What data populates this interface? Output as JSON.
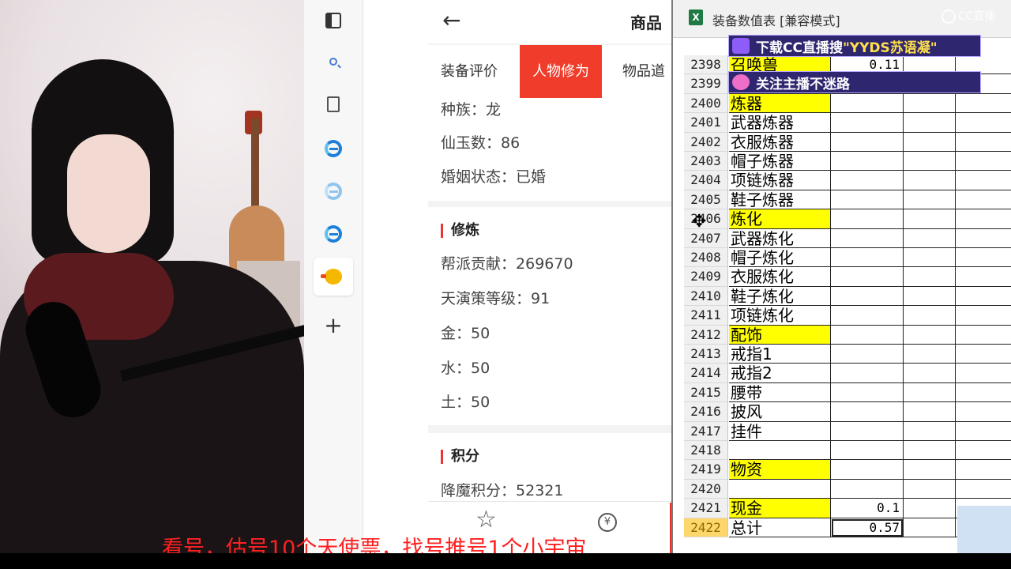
{
  "product_page": {
    "title": "商品",
    "tabs": [
      "装备评价",
      "人物修为",
      "物品道"
    ],
    "active_tab_index": 1,
    "info_rows": [
      {
        "label": "种族：",
        "value": "龙"
      },
      {
        "label": "仙玉数：",
        "value": "86"
      },
      {
        "label": "婚姻状态：",
        "value": "已婚"
      }
    ],
    "cultivation": {
      "title": "修炼",
      "rows": [
        {
          "label": "帮派贡献：",
          "value": "269670"
        },
        {
          "label": "天演策等级：",
          "value": "91"
        },
        {
          "label": "金：",
          "value": "50"
        },
        {
          "label": "水：",
          "value": "50"
        },
        {
          "label": "土：",
          "value": "50"
        }
      ]
    },
    "points": {
      "title": "积分",
      "rows": [
        {
          "label": "降魔积分：",
          "value": "52321"
        }
      ]
    }
  },
  "excel": {
    "title": "装备数值表 [兼容模式]",
    "rows": [
      {
        "num": "2398",
        "a": "召唤兽",
        "b": "0.11",
        "hl": true
      },
      {
        "num": "2399",
        "a": "",
        "b": ""
      },
      {
        "num": "2400",
        "a": "炼器",
        "b": "",
        "hl": true
      },
      {
        "num": "2401",
        "a": "武器炼器",
        "b": ""
      },
      {
        "num": "2402",
        "a": "衣服炼器",
        "b": ""
      },
      {
        "num": "2403",
        "a": "帽子炼器",
        "b": ""
      },
      {
        "num": "2404",
        "a": "项链炼器",
        "b": ""
      },
      {
        "num": "2405",
        "a": "鞋子炼器",
        "b": ""
      },
      {
        "num": "2406",
        "a": "炼化",
        "b": "",
        "hl": true
      },
      {
        "num": "2407",
        "a": "武器炼化",
        "b": ""
      },
      {
        "num": "2408",
        "a": "帽子炼化",
        "b": ""
      },
      {
        "num": "2409",
        "a": "衣服炼化",
        "b": ""
      },
      {
        "num": "2410",
        "a": "鞋子炼化",
        "b": ""
      },
      {
        "num": "2411",
        "a": "项链炼化",
        "b": ""
      },
      {
        "num": "2412",
        "a": "配饰",
        "b": "",
        "hl": true
      },
      {
        "num": "2413",
        "a": "戒指1",
        "b": ""
      },
      {
        "num": "2414",
        "a": "戒指2",
        "b": ""
      },
      {
        "num": "2415",
        "a": "腰带",
        "b": ""
      },
      {
        "num": "2416",
        "a": "披风",
        "b": ""
      },
      {
        "num": "2417",
        "a": "挂件",
        "b": ""
      },
      {
        "num": "2418",
        "a": "",
        "b": ""
      },
      {
        "num": "2419",
        "a": "物资",
        "b": "",
        "hl": true
      },
      {
        "num": "2420",
        "a": "",
        "b": ""
      },
      {
        "num": "2421",
        "a": "现金",
        "b": "0.1",
        "hl": true
      },
      {
        "num": "2422",
        "a": "总计",
        "b": "0.57",
        "selected": true
      }
    ]
  },
  "overlays": {
    "cc_logo": "CC直播",
    "banner1_prefix": "下载CC直播搜",
    "banner1_highlight": "\"YYDS苏语凝\"",
    "banner2": "关注主播不迷路",
    "subtitle": "看号，估号10个天使票，找号推号1个小宇宙"
  },
  "colors": {
    "accent_red": "#f03c2b",
    "cell_highlight": "#ffff00",
    "banner_bg": "#2f2670"
  }
}
